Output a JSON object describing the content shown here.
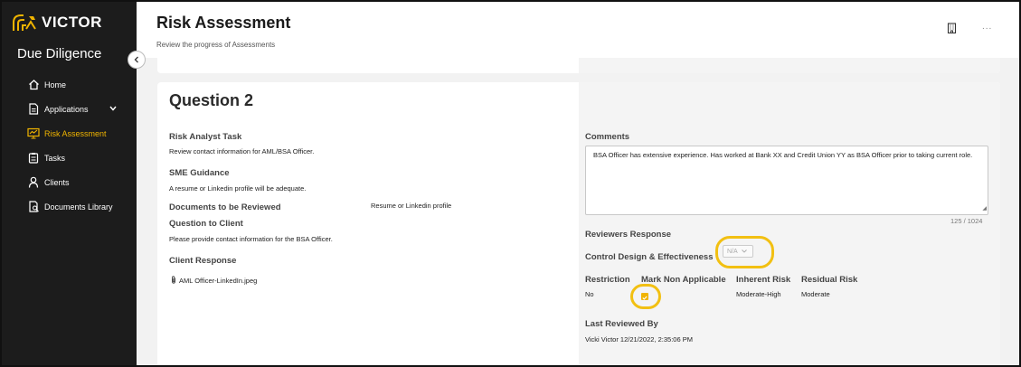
{
  "brand": {
    "logo_text": "VICTOR",
    "app_name": "Due Diligence",
    "accent": "#f0b400"
  },
  "sidebar": {
    "items": [
      {
        "label": "Home",
        "icon": "home-icon"
      },
      {
        "label": "Applications",
        "icon": "document-icon",
        "expandable": true
      },
      {
        "label": "Risk Assessment",
        "icon": "risk-assessment-icon",
        "active": true
      },
      {
        "label": "Tasks",
        "icon": "tasks-icon"
      },
      {
        "label": "Clients",
        "icon": "user-icon"
      },
      {
        "label": "Documents Library",
        "icon": "documents-library-icon"
      }
    ]
  },
  "header": {
    "title": "Risk Assessment",
    "subtitle": "Review the progress of Assessments",
    "more_label": "..."
  },
  "question": {
    "title": "Question 2",
    "risk_analyst_task_label": "Risk Analyst Task",
    "risk_analyst_task": "Review contact information for AML/BSA Officer.",
    "sme_guidance_label": "SME Guidance",
    "sme_guidance": "A resume or Linkedin profile will be adequate.",
    "documents_label": "Documents to be Reviewed",
    "documents": "Resume or Linkedin profile",
    "question_to_client_label": "Question to Client",
    "question_to_client": "Please provide contact information for the BSA Officer.",
    "client_response_label": "Client Response",
    "attachment": "AML Officer-LinkedIn.jpeg"
  },
  "review": {
    "comments_label": "Comments",
    "comments": "BSA Officer has extensive experience. Has worked at Bank XX and Credit Union YY as BSA Officer prior to taking current role.",
    "char_count": "125 / 1024",
    "reviewers_response_label": "Reviewers Response",
    "control_design_label": "Control Design & Effectiveness",
    "control_design_value": "N/A",
    "restriction_label": "Restriction",
    "restriction_value": "No",
    "mark_na_label": "Mark Non Applicable",
    "mark_na_checked": true,
    "inherent_risk_label": "Inherent Risk",
    "inherent_risk_value": "Moderate-High",
    "residual_risk_label": "Residual Risk",
    "residual_risk_value": "Moderate",
    "last_reviewed_label": "Last Reviewed By",
    "last_reviewed_value": "Vicki Victor 12/21/2022, 2:35:06 PM"
  }
}
